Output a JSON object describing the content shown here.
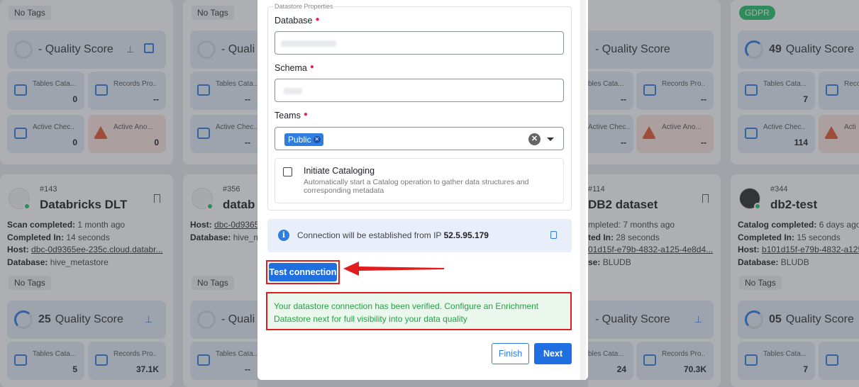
{
  "background": {
    "col1_top": {
      "tag": "No Tags",
      "quality_score_label": "- Quality Score",
      "tables_label": "Tables Cata...",
      "tables_value": "0",
      "records_label": "Records Pro...",
      "records_value": "--",
      "active_checks_label": "Active Chec...",
      "active_checks_value": "0",
      "active_anomalies_label": "Active Ano...",
      "active_anomalies_value": "0"
    },
    "col2_top": {
      "tag": "No Tags",
      "quality_score_label": "- Quali",
      "tables_label": "Tables Cata...",
      "tables_value": "--",
      "active_checks_label": "Active Chec...",
      "active_checks_value": "--"
    },
    "col3_top": {
      "quality_score_label": "- Quality Score",
      "tables_label": "bles Cata...",
      "tables_value": "--",
      "records_label": "Records Pro...",
      "records_value": "--",
      "active_checks_label": "Active Chec...",
      "active_checks_value": "--",
      "active_anomalies_label": "Active Ano...",
      "active_anomalies_value": "--"
    },
    "col4_top": {
      "tag": "GDPR",
      "quality_score_value": "49",
      "quality_score_label": "Quality Score",
      "tables_label": "Tables Cata...",
      "tables_value": "7",
      "records_label": "Reco",
      "active_checks_label": "Active Chec...",
      "active_checks_value": "114",
      "active_anomalies_label": "Acti"
    },
    "card_databricks": {
      "id": "#143",
      "title": "Databricks DLT",
      "scan_label": "Scan completed:",
      "scan_value": "1 month ago",
      "completed_label": "Completed In:",
      "completed_value": "14 seconds",
      "host_label": "Host:",
      "host_value": "dbc-0d9365ee-235c.cloud.databr...",
      "database_label": "Database:",
      "database_value": "hive_metastore",
      "tag": "No Tags",
      "quality_score_value": "25",
      "quality_score_label": "Quality Score",
      "tables_label": "Tables Cata...",
      "tables_value": "5",
      "records_label": "Records Pro...",
      "records_value": "37.1K"
    },
    "card_datab": {
      "id": "#356",
      "title": "datab",
      "host_label": "Host:",
      "host_value": "dbc-0d9365",
      "database_label": "Database:",
      "database_value": "hive_m",
      "tag": "No Tags",
      "quality_score_label": "- Quali",
      "tables_label": "Tables Cata...",
      "tables_value": "--"
    },
    "card_db2_dataset": {
      "id": "#114",
      "title": "DB2 dataset",
      "scan_value": "mpleted: 7 months ago",
      "completed_label": "ted In:",
      "completed_value": "28 seconds",
      "host_value": "01d15f-e79b-4832-a125-4e8d4...",
      "database_label": "se:",
      "database_value": "BLUDB",
      "quality_score_label": "- Quality Score",
      "tables_label": "bles Cata...",
      "tables_value": "24",
      "records_label": "Records Pro...",
      "records_value": "70.3K"
    },
    "card_db2_test": {
      "id": "#344",
      "title": "db2-test",
      "catalog_label": "Catalog completed:",
      "catalog_value": "6 days ago",
      "completed_label": "Completed In:",
      "completed_value": "15 seconds",
      "host_label": "Host:",
      "host_value": "b101d15f-e79b-4832-a125",
      "database_label": "Database:",
      "database_value": "BLUDB",
      "tag": "No Tags",
      "quality_score_value": "05",
      "quality_score_label": "Quality Score",
      "tables_label": "Tables Cata...",
      "tables_value": "7"
    }
  },
  "modal": {
    "legend": "Datastore Properties",
    "database_label": "Database",
    "schema_label": "Schema",
    "teams_label": "Teams",
    "team_chip": "Public",
    "catalog_checkbox_label": "Initiate Cataloging",
    "catalog_description": "Automatically start a Catalog operation to gather data structures and corresponding metadata",
    "connection_info_prefix": "Connection will be established from IP",
    "connection_ip": "52.5.95.179",
    "test_button": "Test connection",
    "success_message": "Your datastore connection has been verified. Configure an Enrichment Datastore next for full visibility into your data quality",
    "finish_button": "Finish",
    "next_button": "Next"
  },
  "colors": {
    "primary": "#1f6fe0",
    "highlight_red": "#e11d1d",
    "success_green": "#27a047",
    "gdpr_green": "#27c26c"
  }
}
